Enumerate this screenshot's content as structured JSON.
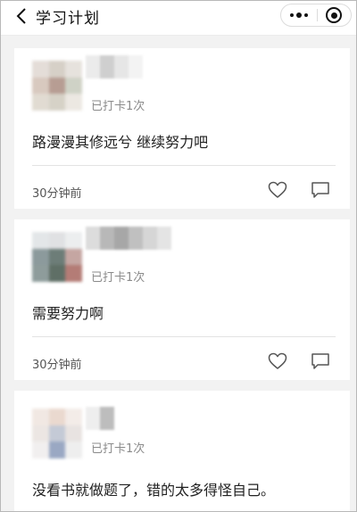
{
  "header": {
    "title": "学习计划",
    "back_icon": "chevron-left-icon",
    "menu_icon": "more-dots-icon",
    "close_icon": "target-close-icon"
  },
  "posts": [
    {
      "checkin": "已打卡1次",
      "content": "路漫漫其修远兮 继续努力吧",
      "time": "30分钟前",
      "avatar_colors": [
        "#e4ddd8",
        "#d6d0c7",
        "#e6e2dd",
        "#d8c9bf",
        "#b79d93",
        "#cfd2c6",
        "#e1dbd2",
        "#d6d2c7",
        "#ece8e2"
      ],
      "name_colors": [
        "#ebebeb",
        "#cfcfcf",
        "#e6e6e6",
        "#f3f3f3"
      ]
    },
    {
      "checkin": "已打卡1次",
      "content": "需要努力啊",
      "time": "30分钟前",
      "avatar_colors": [
        "#e3e6e8",
        "#e0e1e3",
        "#eceeef",
        "#8c9a9c",
        "#6d7d78",
        "#c5a6a2",
        "#8e9c9b",
        "#5f6f66",
        "#b47c76"
      ],
      "name_colors": [
        "#dcdcdc",
        "#b8b8b8",
        "#a7a7a7",
        "#c0c0c0",
        "#d6d6d6",
        "#e4e4e4"
      ]
    },
    {
      "checkin": "已打卡1次",
      "content": "没看书就做题了，错的太多得怪自己。",
      "time": "",
      "avatar_colors": [
        "#f1e8e3",
        "#ead9cf",
        "#f3ece8",
        "#ece6e3",
        "#c4cad6",
        "#e8e3e1",
        "#f1efef",
        "#9aa8c3",
        "#eeeeee"
      ],
      "name_colors": [
        "#eeeeee",
        "#bdbdbd"
      ]
    }
  ]
}
